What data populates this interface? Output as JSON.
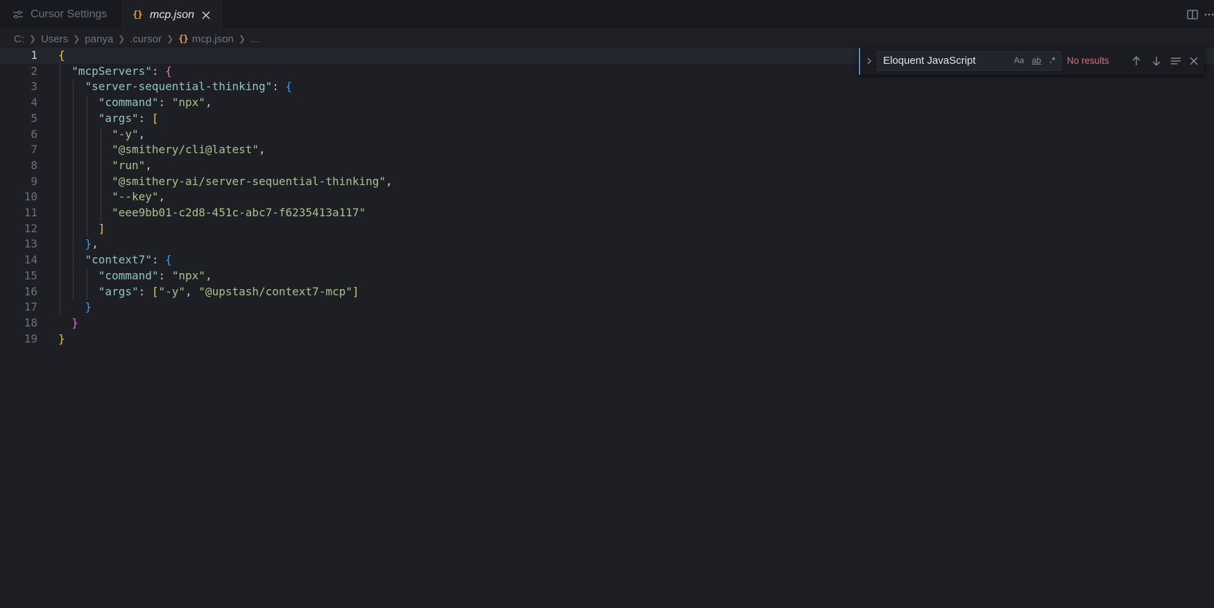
{
  "tabs": [
    {
      "label": "Cursor Settings",
      "icon": "settings-sliders-icon",
      "active": false
    },
    {
      "label": "mcp.json",
      "icon": "json-braces-icon",
      "active": true
    }
  ],
  "breadcrumb": [
    "C:",
    "Users",
    "panya",
    ".cursor",
    "mcp.json",
    "..."
  ],
  "find": {
    "query": "Eloquent JavaScript",
    "match_case_label": "Aa",
    "whole_word_label": "ab",
    "regex_label": ".*",
    "status": "No results"
  },
  "editor": {
    "current_line": 1,
    "line_numbers": [
      "1",
      "2",
      "3",
      "4",
      "5",
      "6",
      "7",
      "8",
      "9",
      "10",
      "11",
      "12",
      "13",
      "14",
      "15",
      "16",
      "17",
      "18",
      "19"
    ],
    "tokens": {
      "l1_open": "{",
      "l2_key": "\"mcpServers\"",
      "l2_colon": ": ",
      "l2_open": "{",
      "l3_key": "\"server-sequential-thinking\"",
      "l3_colon": ": ",
      "l3_open": "{",
      "l4_key": "\"command\"",
      "l4_colon": ": ",
      "l4_val": "\"npx\"",
      "l4_comma": ",",
      "l5_key": "\"args\"",
      "l5_colon": ": ",
      "l5_open": "[",
      "l6_val": "\"-y\"",
      "l6_comma": ",",
      "l7_val": "\"@smithery/cli@latest\"",
      "l7_comma": ",",
      "l8_val": "\"run\"",
      "l8_comma": ",",
      "l9_val": "\"@smithery-ai/server-sequential-thinking\"",
      "l9_comma": ",",
      "l10_val": "\"--key\"",
      "l10_comma": ",",
      "l11_val": "\"eee9bb01-c2d8-451c-abc7-f6235413a117\"",
      "l12_close": "]",
      "l13_close": "}",
      "l13_comma": ",",
      "l14_key": "\"context7\"",
      "l14_colon": ": ",
      "l14_open": "{",
      "l15_key": "\"command\"",
      "l15_colon": ": ",
      "l15_val": "\"npx\"",
      "l15_comma": ",",
      "l16_key": "\"args\"",
      "l16_colon": ": ",
      "l16_open": "[",
      "l16_v1": "\"-y\"",
      "l16_sep": ", ",
      "l16_v2": "\"@upstash/context7-mcp\"",
      "l16_close": "]",
      "l17_close": "}",
      "l18_close": "}",
      "l19_close": "}"
    }
  },
  "colors": {
    "background": "#1d1f24",
    "key": "#8ec7c7",
    "string": "#a9c48a",
    "bracket_level1": "#f2c631",
    "bracket_level2": "#d874d8",
    "bracket_level3": "#3d9be9",
    "no_results": "#e06c75",
    "json_icon": "#e5a33a"
  }
}
